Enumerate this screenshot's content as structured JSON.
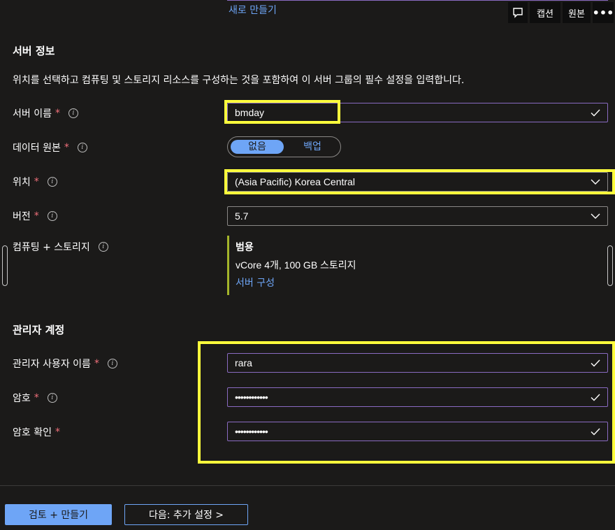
{
  "top_link": "새로 만들기",
  "video_toolbar": {
    "caption_label": "캡션",
    "original_label": "원본"
  },
  "server_info": {
    "heading": "서버 정보",
    "description": "위치를 선택하고 컴퓨팅 및 스토리지 리소스를 구성하는 것을 포함하여 이 서버 그룹의 필수 설정을 입력합니다.",
    "server_name_label": "서버 이름",
    "server_name_value": "bmday",
    "data_source_label": "데이터 원본",
    "data_source_options": [
      "없음",
      "백업"
    ],
    "data_source_selected": "없음",
    "location_label": "위치",
    "location_value": "(Asia Pacific) Korea Central",
    "version_label": "버전",
    "version_value": "5.7",
    "compute_label": "컴퓨팅 + 스토리지",
    "compute_tier": "범용",
    "compute_detail": "vCore 4개, 100 GB 스토리지",
    "compute_link": "서버 구성"
  },
  "admin_account": {
    "heading": "관리자 계정",
    "username_label": "관리자 사용자 이름",
    "username_value": "rara",
    "password_label": "암호",
    "password_value": "••••••••••••",
    "confirm_label": "암호 확인",
    "confirm_value": "••••••••••••"
  },
  "footer": {
    "review_create_label": "검토 + 만들기",
    "next_label": "다음: 추가 설정 >"
  },
  "colors": {
    "background": "#1b1a19",
    "accent": "#6ea5f6",
    "required": "#f1707b",
    "input_border": "#8a6bc2",
    "highlight": "#ffff3c",
    "compute_bar": "#a4b52a"
  }
}
